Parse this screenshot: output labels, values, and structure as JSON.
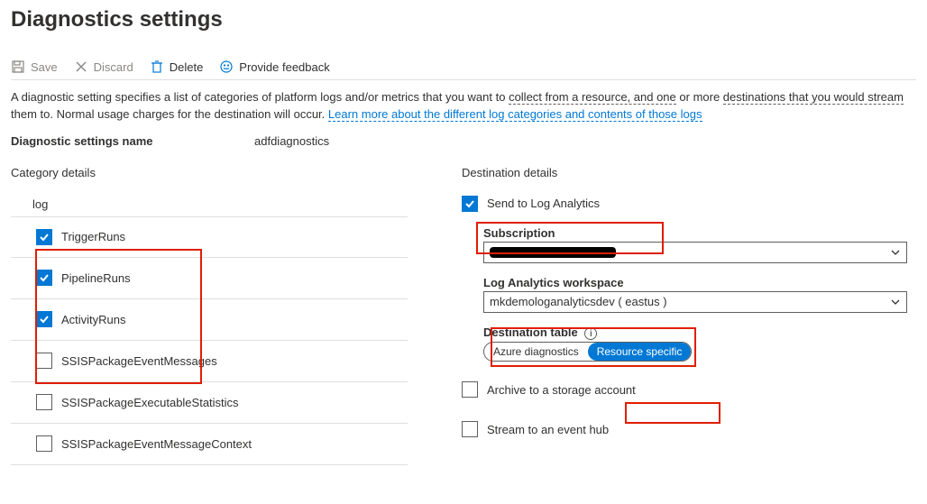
{
  "title": "Diagnostics settings",
  "toolbar": {
    "save": "Save",
    "discard": "Discard",
    "delete": "Delete",
    "feedback": "Provide feedback"
  },
  "description": {
    "part1": "A diagnostic setting specifies a list of categories of platform logs and/or metrics that you want to ",
    "dotted1": "collect from a resource, and one",
    "part2": " or more ",
    "dotted2": "destinations that you would stream",
    "part3": " them to. Normal usage charges for the destination will occur. ",
    "link": "Learn more about the different log categories and contents of those logs"
  },
  "settings_name_label": "Diagnostic settings name",
  "settings_name_value": "adfdiagnostics",
  "left": {
    "section": "Category details",
    "log_heading": "log",
    "items": [
      {
        "label": "TriggerRuns",
        "checked": true
      },
      {
        "label": "PipelineRuns",
        "checked": true
      },
      {
        "label": "ActivityRuns",
        "checked": true
      },
      {
        "label": "SSISPackageEventMessages",
        "checked": false
      },
      {
        "label": "SSISPackageExecutableStatistics",
        "checked": false
      },
      {
        "label": "SSISPackageEventMessageContext",
        "checked": false
      }
    ]
  },
  "right": {
    "section": "Destination details",
    "send_label": "Send to Log Analytics",
    "subscription_label": "Subscription",
    "workspace_label": "Log Analytics workspace",
    "workspace_value": "mkdemologanalyticsdev ( eastus )",
    "dest_table_label": "Destination table",
    "toggle": {
      "a": "Azure diagnostics",
      "b": "Resource specific"
    },
    "archive_label": "Archive to a storage account",
    "stream_label": "Stream to an event hub"
  }
}
